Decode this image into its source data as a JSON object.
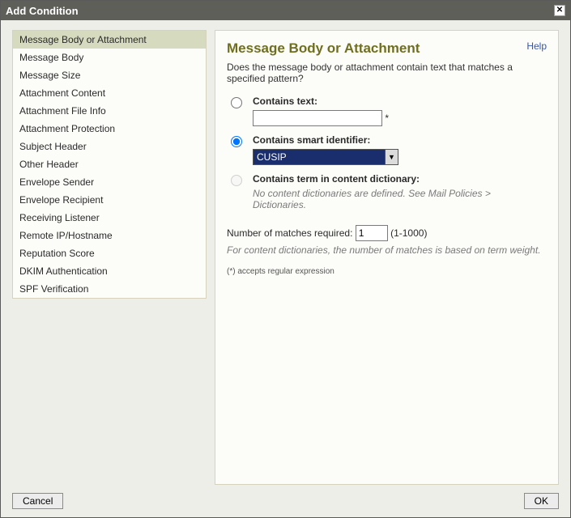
{
  "dialog": {
    "title": "Add Condition"
  },
  "sidebar": {
    "items": [
      {
        "label": "Message Body or Attachment",
        "selected": true
      },
      {
        "label": "Message Body"
      },
      {
        "label": "Message Size"
      },
      {
        "label": "Attachment Content"
      },
      {
        "label": "Attachment File Info"
      },
      {
        "label": "Attachment Protection"
      },
      {
        "label": "Subject Header"
      },
      {
        "label": "Other Header"
      },
      {
        "label": "Envelope Sender"
      },
      {
        "label": "Envelope Recipient"
      },
      {
        "label": "Receiving Listener"
      },
      {
        "label": "Remote IP/Hostname"
      },
      {
        "label": "Reputation Score"
      },
      {
        "label": "DKIM Authentication"
      },
      {
        "label": "SPF Verification"
      }
    ]
  },
  "main": {
    "help": "Help",
    "title": "Message Body or Attachment",
    "description": "Does the message body or attachment contain text that matches a specified pattern?",
    "options": {
      "contains_text": {
        "label": "Contains text:",
        "value": "",
        "asterisk": "*"
      },
      "contains_smart": {
        "label": "Contains smart identifier:",
        "selected_value": "CUSIP"
      },
      "contains_dict": {
        "label": "Contains term in content dictionary:",
        "note": "No content dictionaries are defined. See Mail Policies > Dictionaries."
      }
    },
    "matches": {
      "label": "Number of matches required: ",
      "value": "1",
      "range": " (1-1000)",
      "note": "For content dictionaries, the number of matches is based on term weight."
    },
    "footnote": "(*) accepts regular expression"
  },
  "footer": {
    "cancel": "Cancel",
    "ok": "OK"
  }
}
